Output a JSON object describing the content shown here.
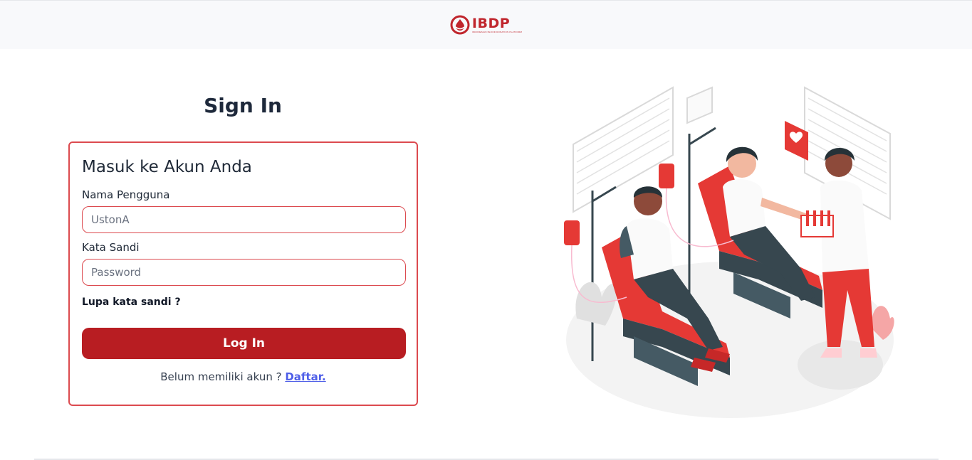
{
  "header": {
    "logo_text": "IBDP",
    "logo_subtext": "INDONESIAN BLOOD DONATION PLATFORM"
  },
  "page": {
    "title": "Sign In"
  },
  "login_card": {
    "heading": "Masuk ke Akun Anda",
    "username_label": "Nama Pengguna",
    "username_value": "UstonA",
    "password_label": "Kata Sandi",
    "password_placeholder": "Password",
    "forgot_link": "Lupa kata sandi ?",
    "login_button": "Log In",
    "register_prompt": "Belum memiliki akun ?",
    "register_link": "Daftar."
  },
  "colors": {
    "brand_red": "#b81d22",
    "border_red": "#dc4a4f",
    "link_blue": "#4f5fe8",
    "header_bg": "#f8f9fb"
  },
  "illustration": {
    "icon": "blood-donation-illustration"
  }
}
